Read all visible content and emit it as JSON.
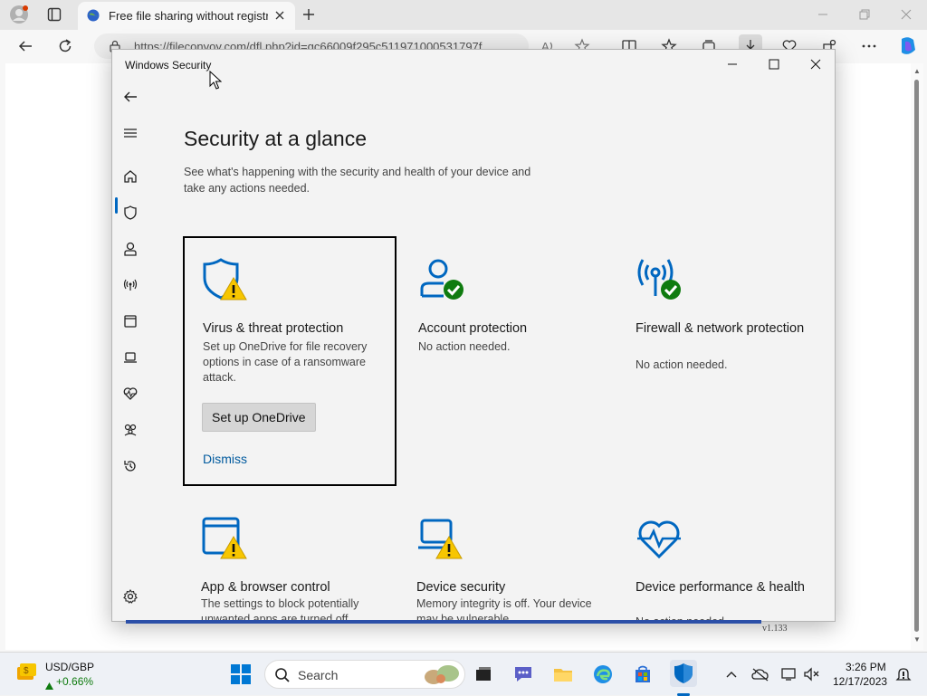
{
  "browser": {
    "tab_title": "Free file sharing without registrat",
    "url": "https://fileconvoy.com/dfl.php?id=gc66009f295c511971000531797f",
    "colors": {
      "chrome": "#e6e6e6",
      "accent": "#0067c0"
    }
  },
  "window": {
    "title": "Windows Security",
    "caption": {
      "minimize": "minimize-icon",
      "maximize": "maximize-icon",
      "close": "close-icon"
    }
  },
  "nav": {
    "items": [
      "back-icon",
      "menu-icon",
      "home-icon",
      "shield-icon",
      "person-icon",
      "wireless-icon",
      "app-browser-icon",
      "laptop-icon",
      "heart-pulse-icon",
      "family-icon",
      "history-icon",
      "settings-icon"
    ],
    "selected": "home-icon"
  },
  "page": {
    "heading": "Security at a glance",
    "subheading": "See what's happening with the security and health of your device and take any actions needed."
  },
  "cards": {
    "virus": {
      "title": "Virus & threat protection",
      "desc": "Set up OneDrive for file recovery options in case of a ransomware attack.",
      "button": "Set up OneDrive",
      "link": "Dismiss",
      "status": "warning"
    },
    "account": {
      "title": "Account protection",
      "desc": "No action needed.",
      "status": "ok"
    },
    "firewall": {
      "title": "Firewall & network protection",
      "desc": "No action needed.",
      "status": "ok"
    },
    "app_browser": {
      "title": "App & browser control",
      "desc": "The settings to block potentially unwanted apps are turned off.",
      "status": "warning"
    },
    "device_security": {
      "title": "Device security",
      "desc": "Memory integrity is off. Your device may be vulnerable.",
      "status": "warning"
    },
    "device_perf": {
      "title": "Device performance & health",
      "desc": "No action needed.",
      "status": "ok"
    }
  },
  "version": "v1.133",
  "taskbar": {
    "ticker_symbol": "USD/GBP",
    "ticker_change": "+0.66%",
    "search_placeholder": "Search",
    "time": "3:26 PM",
    "date": "12/17/2023"
  }
}
